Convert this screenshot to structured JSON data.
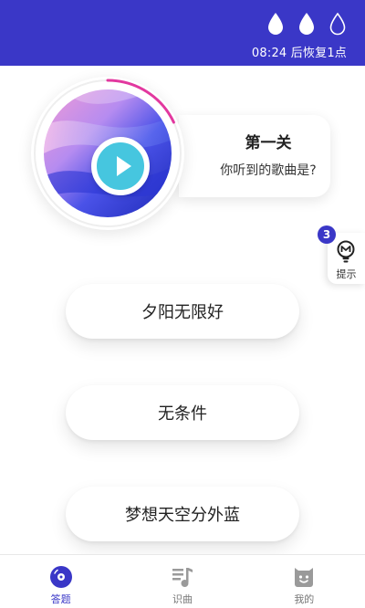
{
  "header": {
    "lives_total": 3,
    "lives_filled": 2,
    "restore_text": "08:24 后恢复1点",
    "bg_color": "#3a37c7"
  },
  "player": {
    "progress": 0.18,
    "progress_color": "#e2389f",
    "play_icon": "play-icon"
  },
  "level": {
    "title": "第一关",
    "question": "你听到的歌曲是?"
  },
  "hint": {
    "count": "3",
    "label": "提示",
    "icon": "lightbulb-icon"
  },
  "answers": [
    {
      "label": "夕阳无限好"
    },
    {
      "label": "无条件"
    },
    {
      "label": "梦想天空分外蓝"
    }
  ],
  "nav": {
    "items": [
      {
        "label": "答题",
        "icon": "disc-icon",
        "active": true
      },
      {
        "label": "识曲",
        "icon": "music-list-icon",
        "active": false
      },
      {
        "label": "我的",
        "icon": "profile-face-icon",
        "active": false
      }
    ],
    "active_color": "#3a37c7"
  }
}
